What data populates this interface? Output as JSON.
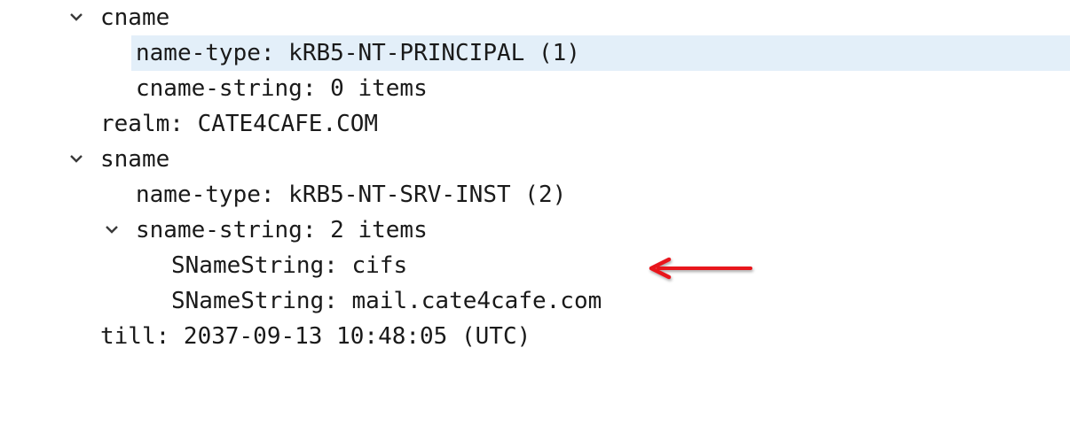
{
  "tree": {
    "rows": [
      {
        "label": "cname",
        "expanded": true
      },
      {
        "label": "name-type: kRB5-NT-PRINCIPAL (1)",
        "selected": true
      },
      {
        "label": "cname-string: 0 items"
      },
      {
        "label": "realm: CATE4CAFE.COM"
      },
      {
        "label": "sname",
        "expanded": true
      },
      {
        "label": "name-type: kRB5-NT-SRV-INST (2)"
      },
      {
        "label": "sname-string: 2 items",
        "expanded": true
      },
      {
        "label": "SNameString: cifs"
      },
      {
        "label": "SNameString: mail.cate4cafe.com"
      },
      {
        "label": "till: 2037-09-13 10:48:05 (UTC)"
      }
    ]
  },
  "colors": {
    "selection": "#e3eff9",
    "annotation_arrow": "#e8141c",
    "text": "#1a1a1a"
  },
  "icons": {
    "expand": "chevron-down-icon",
    "annotation": "red-arrow-icon"
  }
}
